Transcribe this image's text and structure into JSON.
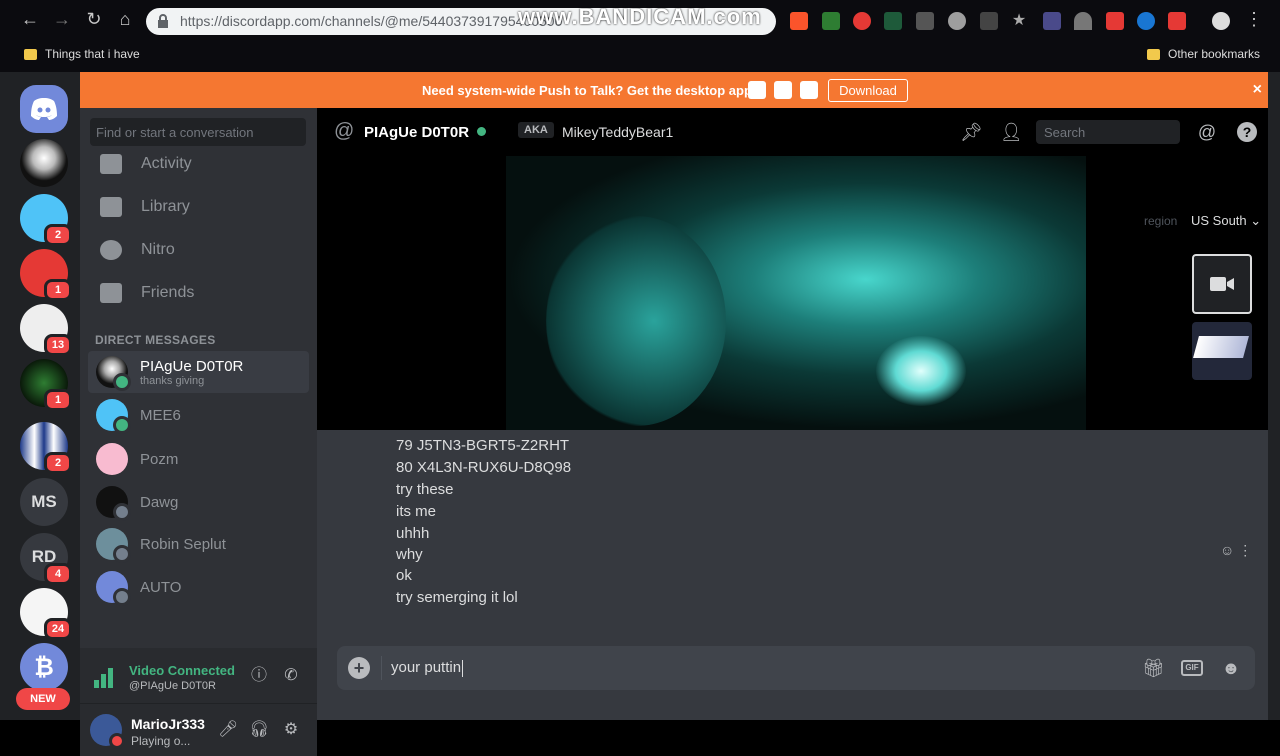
{
  "browser": {
    "url": "https://discordapp.com/channels/@me/544037391795400500",
    "watermark": "www.BANDICAM.com",
    "bookmarks": {
      "left": "Things that i have",
      "right": "Other bookmarks"
    }
  },
  "banner": {
    "message": "Need system-wide Push to Talk? Get the desktop app!",
    "button": "Download",
    "close": "×",
    "color": "#f57731"
  },
  "guilds": {
    "badges": [
      "2",
      "1",
      "13",
      "1",
      "2",
      "4",
      "24"
    ],
    "text_guilds": [
      "MS",
      "RD"
    ],
    "new_label": "NEW"
  },
  "dm_sidebar": {
    "search_placeholder": "Find or start a conversation",
    "nav": [
      "Activity",
      "Library",
      "Nitro",
      "Friends"
    ],
    "heading": "DIRECT MESSAGES",
    "items": [
      {
        "name": "PIAgUe D0T0R",
        "sub": "thanks giving"
      },
      {
        "name": "MEE6",
        "sub": ""
      },
      {
        "name": "Pozm",
        "sub": ""
      },
      {
        "name": "Dawg",
        "sub": ""
      },
      {
        "name": "Robin Seplut",
        "sub": ""
      },
      {
        "name": "AUTO",
        "sub": ""
      }
    ]
  },
  "voice": {
    "title": "Video Connected",
    "sub": "@PIAgUe D0T0R"
  },
  "user": {
    "name": "MarioJr333",
    "status": "Playing o..."
  },
  "chat": {
    "title": "PIAgUe D0T0R",
    "aka_label": "AKA",
    "aka_name": "MikeyTeddyBear1",
    "search_placeholder": "Search",
    "region_label": "region",
    "region_value": "US South",
    "messages": [
      "79   J5TN3-BGRT5-Z2RHT",
      "80   X4L3N-RUX6U-D8Q98",
      "try these",
      "its me",
      "uhhh",
      "why",
      "ok",
      "try semerging it lol"
    ],
    "composer_value": "your puttin",
    "gif_label": "GIF"
  },
  "colors": {
    "online": "#43b581",
    "badge": "#f04747",
    "blurple": "#7289da"
  }
}
